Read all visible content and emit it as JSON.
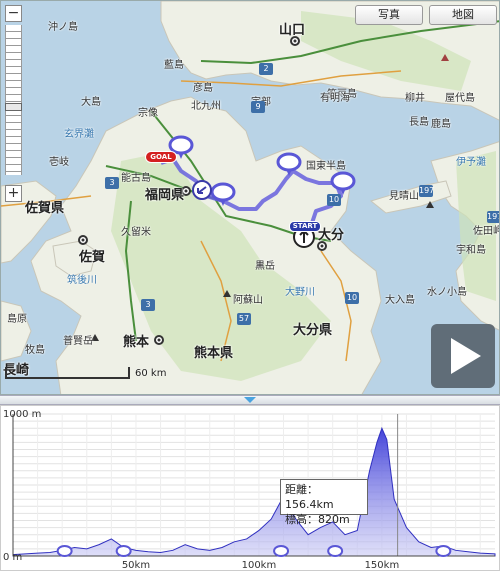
{
  "map": {
    "buttons": {
      "photo": "写真",
      "map": "地図"
    },
    "zoom": {
      "minus": "−",
      "plus": "+"
    },
    "scale_label": "60 km",
    "markers": {
      "goal": "GOAL",
      "start": "START"
    },
    "labels": {
      "okinoshima": "沖ノ島",
      "yamaguchi": "山口",
      "ainoshima": "藍島",
      "hikoshima": "彦島",
      "kitakyushu": "北九州",
      "oshima": "大島",
      "munakata": "宗像",
      "ube": "宇部",
      "kasado": "笠戸島",
      "yashiro": "屋代島",
      "yanai": "柳井",
      "nagashima": "長島",
      "iki": "壱岐",
      "genkainada": "玄界灘",
      "nokonoshima": "能古島",
      "fukuoka": "福岡県",
      "kunisaki": "国東半島",
      "saga_pref": "佐賀県",
      "kurume": "久留米",
      "saga": "佐賀",
      "chikugo": "筑後川",
      "oita_city": "大分",
      "kuroyama": "黒岳",
      "aso": "阿蘇山",
      "oita_pref": "大分県",
      "kumamoto_pref": "熊本県",
      "kumamoto": "熊本",
      "ariake": "有明海",
      "unzen": "普賢岳",
      "makishima": "牧島",
      "nagasaki": "長崎",
      "shimabara": "島原",
      "mishima": "見晴山",
      "iyonada": "伊予灘",
      "sadamisaki": "佐田岬",
      "uwajima": "宇和島",
      "mizunokojima": "水ノ小島",
      "ooiri": "大入島",
      "onojima": "大野川",
      "kakuma": "鹿島"
    },
    "shields": [
      "2",
      "9",
      "3",
      "10",
      "10",
      "197",
      "197",
      "57",
      "3"
    ]
  },
  "chart_data": {
    "type": "area",
    "title": "",
    "xlabel": "",
    "ylabel": "",
    "x_unit": "km",
    "y_unit": "m",
    "xlim": [
      0,
      196
    ],
    "ylim": [
      0,
      1000
    ],
    "x_ticks": [
      "0m",
      "50km",
      "100km",
      "150km"
    ],
    "y_ticks": [
      "0 m",
      "1000 m"
    ],
    "x": [
      0,
      5,
      10,
      15,
      20,
      25,
      30,
      35,
      40,
      45,
      50,
      55,
      60,
      65,
      70,
      75,
      80,
      85,
      90,
      95,
      100,
      105,
      110,
      115,
      120,
      125,
      130,
      135,
      140,
      142,
      145,
      148,
      150,
      152,
      155,
      160,
      165,
      170,
      175,
      180,
      185,
      190,
      196
    ],
    "y": [
      10,
      15,
      20,
      25,
      40,
      60,
      50,
      80,
      120,
      60,
      40,
      30,
      25,
      40,
      80,
      50,
      40,
      60,
      100,
      120,
      180,
      260,
      420,
      260,
      150,
      200,
      240,
      150,
      180,
      350,
      600,
      800,
      900,
      820,
      400,
      200,
      100,
      60,
      70,
      40,
      30,
      20,
      15
    ],
    "grid": true,
    "waypoints_km": [
      21,
      45,
      109,
      131,
      175
    ],
    "tooltip": {
      "distance": "距離：156.4km",
      "elevation": "標高：820m"
    }
  }
}
